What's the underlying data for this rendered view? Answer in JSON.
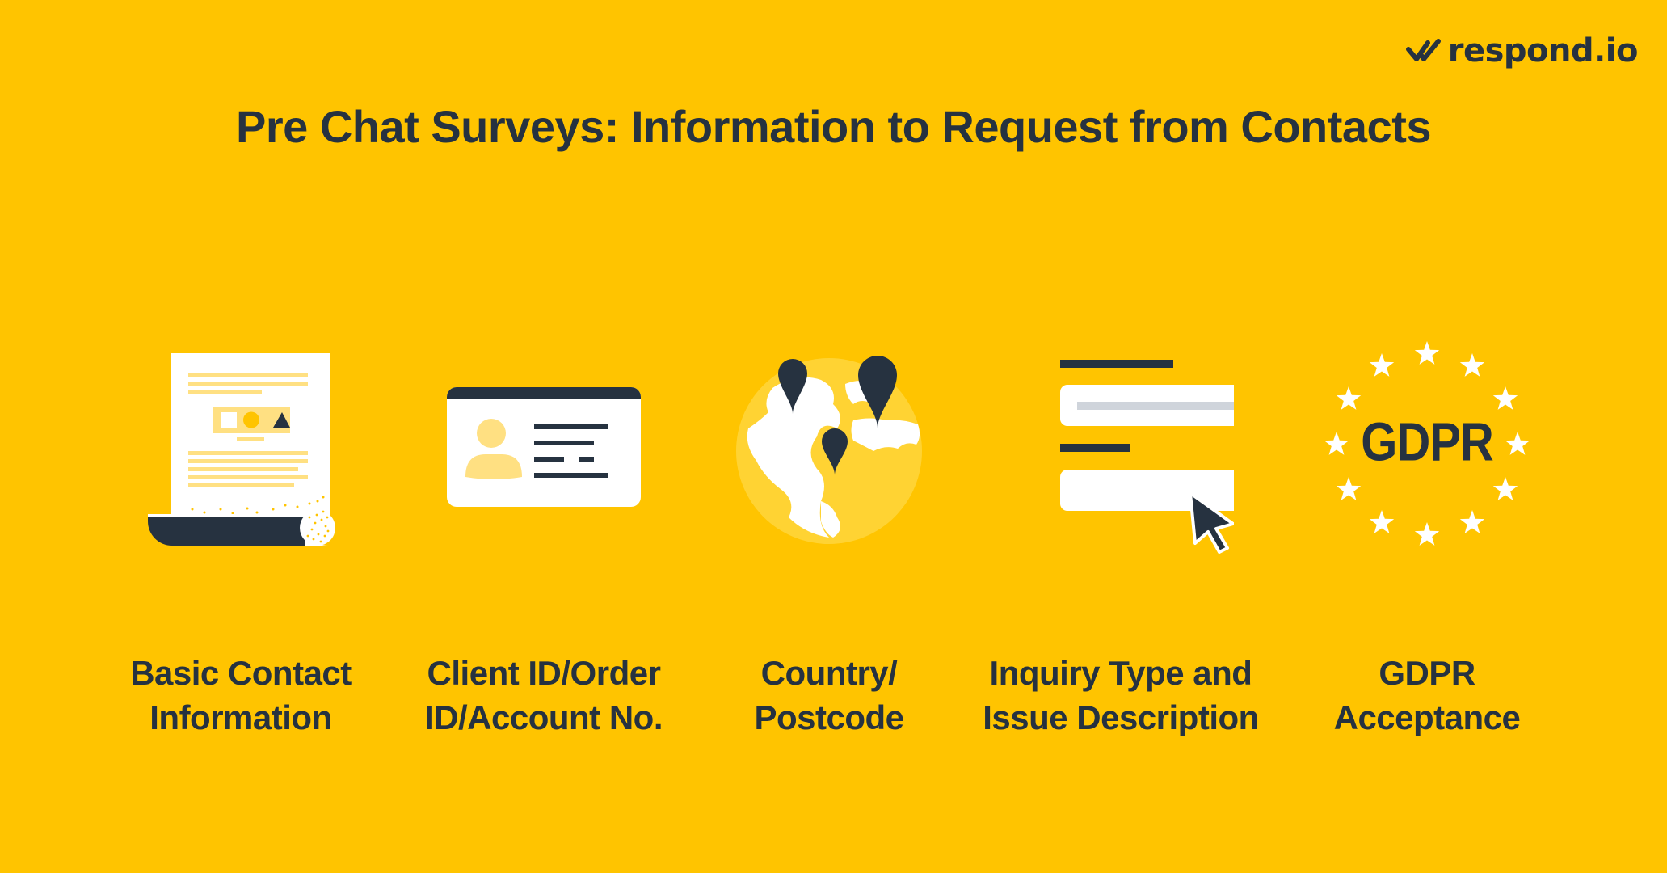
{
  "brand": {
    "name": "respond.io",
    "logo_icon": "double-check-icon"
  },
  "header": {
    "title": "Pre Chat Surveys: Information to Request from Contacts"
  },
  "colors": {
    "background": "#FFC400",
    "dark": "#263240",
    "light_yellow": "#FFE082",
    "white": "#FFFFFF",
    "gray": "#CFD4DB"
  },
  "items": [
    {
      "icon": "document-icon",
      "label_line1": "Basic Contact",
      "label_line2": "Information"
    },
    {
      "icon": "id-card-icon",
      "label_line1": "Client ID/Order",
      "label_line2": "ID/Account No."
    },
    {
      "icon": "globe-pins-icon",
      "label_line1": "Country/",
      "label_line2": "Postcode"
    },
    {
      "icon": "form-cursor-icon",
      "label_line1": "Inquiry Type and",
      "label_line2": "Issue Description"
    },
    {
      "icon": "gdpr-stars-icon",
      "label_line1": "GDPR",
      "label_line2": "Acceptance",
      "badge_text": "GDPR"
    }
  ]
}
